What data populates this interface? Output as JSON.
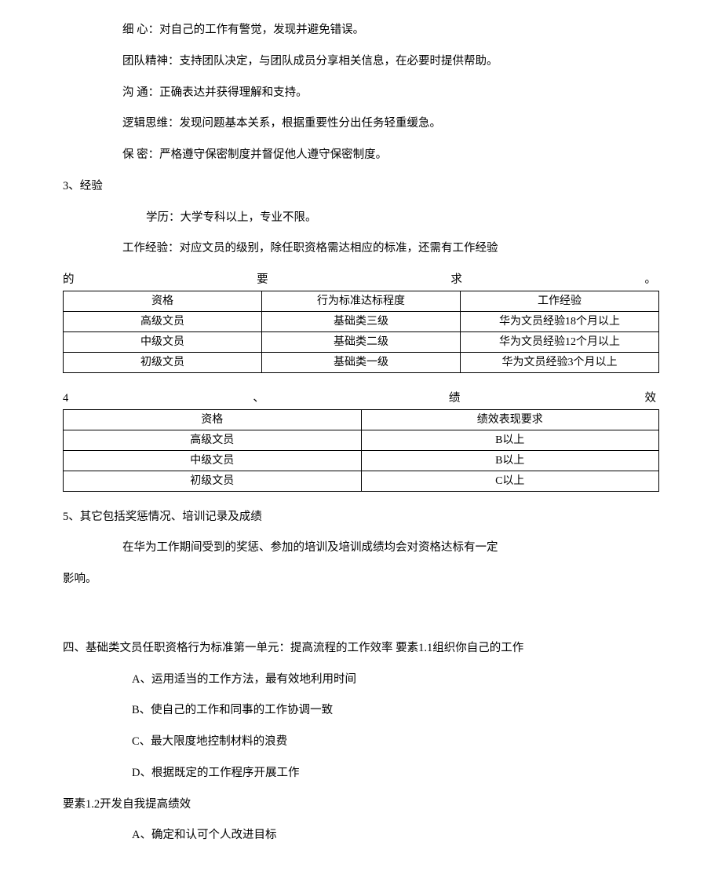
{
  "competencies": [
    {
      "label": "细 心：",
      "text": "对自己的工作有警觉，发现并避免错误。"
    },
    {
      "label": "团队精神：",
      "text": "支持团队决定，与团队成员分享相关信息，在必要时提供帮助。"
    },
    {
      "label": "沟 通：",
      "text": "正确表达并获得理解和支持。"
    },
    {
      "label": "逻辑思维：",
      "text": "发现问题基本关系，根据重要性分出任务轻重缓急。"
    },
    {
      "label": "保 密：",
      "text": "严格遵守保密制度并督促他人遵守保密制度。"
    }
  ],
  "section3_title": "3、经验",
  "education": "学历：大学专科以上，专业不限。",
  "workexp_intro": "工作经验：对应文员的级别，除任职资格需达相应的标准，还需有工作经验",
  "workexp_line_chars": [
    "的",
    "要",
    "求",
    "。"
  ],
  "table1": {
    "headers": [
      "资格",
      "行为标准达标程度",
      "工作经验"
    ],
    "rows": [
      [
        "高级文员",
        "基础类三级",
        "华为文员经验18个月以上"
      ],
      [
        "中级文员",
        "基础类二级",
        "华为文员经验12个月以上"
      ],
      [
        "初级文员",
        "基础类一级",
        "华为文员经验3个月以上"
      ]
    ]
  },
  "section4_chars": [
    "4",
    "、",
    "绩",
    "效"
  ],
  "table2": {
    "headers": [
      "资格",
      "绩效表现要求"
    ],
    "rows": [
      [
        "高级文员",
        "B以上"
      ],
      [
        "中级文员",
        "B以上"
      ],
      [
        "初级文员",
        "C以上"
      ]
    ]
  },
  "section5_title": "5、其它包括奖惩情况、培训记录及成绩",
  "section5_body1": "在华为工作期间受到的奖惩、参加的培训及培训成绩均会对资格达标有一定",
  "section5_body2": "影响。",
  "sectionIV": "四、基础类文员任职资格行为标准第一单元：提高流程的工作效率 要素1.1组织你自己的工作",
  "element11": [
    "A、运用适当的工作方法，最有效地利用时间",
    "B、使自己的工作和同事的工作协调一致",
    "C、最大限度地控制材料的浪费",
    "D、根据既定的工作程序开展工作"
  ],
  "element12_title": "要素1.2开发自我提高绩效",
  "element12": [
    "A、确定和认可个人改进目标"
  ]
}
